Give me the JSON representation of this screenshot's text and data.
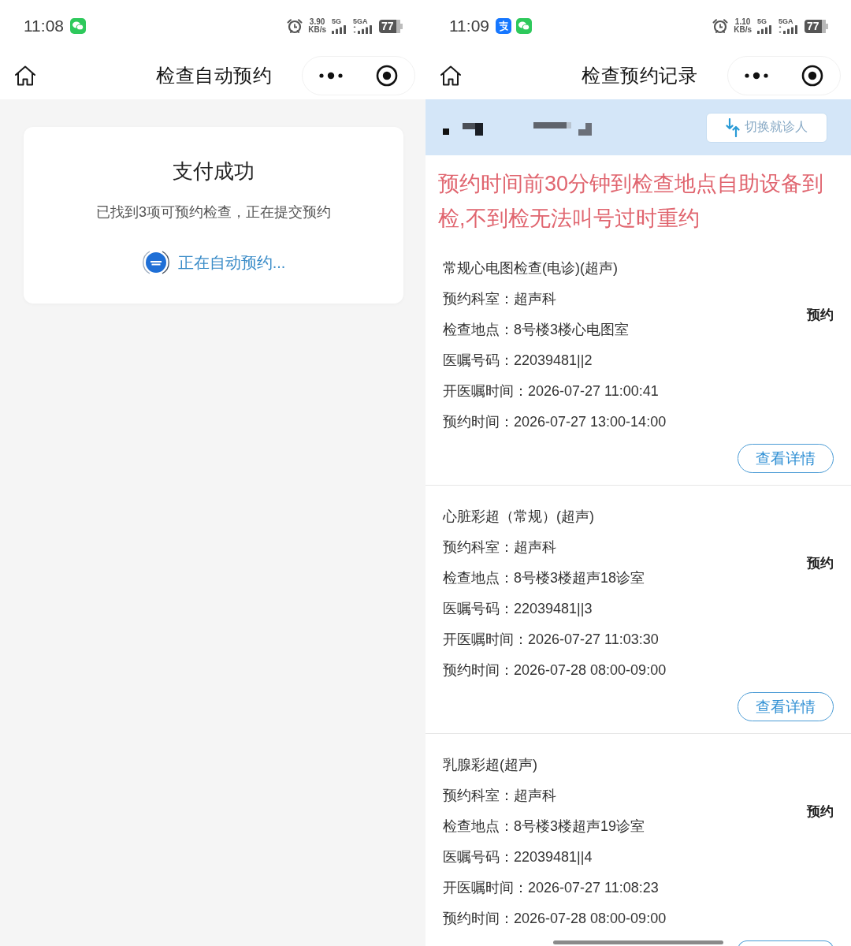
{
  "screens": [
    {
      "kind": "payment_status",
      "status_bar": {
        "time": "11:08",
        "notification_icons": [
          {
            "kind": "chat"
          }
        ],
        "net_speed": "3.90",
        "net_speed_unit": "KB/s",
        "sim_1_label": "5G",
        "sim_2_label": "5GA",
        "battery": "77"
      },
      "nav": {
        "title": "检查自动预约"
      },
      "result_card": {
        "title": "支付成功",
        "message": "已找到3项可预约检查，正在提交预约",
        "progress": "正在自动预约..."
      }
    },
    {
      "kind": "records",
      "status_bar": {
        "time": "11:09",
        "notification_icons": [
          {
            "kind": "pay"
          },
          {
            "kind": "chat"
          }
        ],
        "net_speed": "1.10",
        "net_speed_unit": "KB/s",
        "sim_1_label": "5G",
        "sim_2_label": "5GA",
        "battery": "77"
      },
      "nav": {
        "title": "检查预约记录"
      },
      "patient_bar": {
        "switch_button": "切换就诊人"
      },
      "notice": "预约时间前30分钟到检查地点自助设备到检,不到检无法叫号过时重约",
      "records": [
        {
          "name": "常规心电图检查(电诊)(超声)",
          "fields": [
            "预约科室：超声科",
            "检查地点：8号楼3楼心电图室",
            "医嘱号码：22039481||2",
            "开医嘱时间：2026-07-27 11:00:41",
            "预约时间：2026-07-27 13:00-14:00"
          ],
          "status": "预约",
          "action": {
            "kind": "button",
            "label": "查看详情"
          }
        },
        {
          "name": "心脏彩超（常规）(超声)",
          "fields": [
            "预约科室：超声科",
            "检查地点：8号楼3楼超声18诊室",
            "医嘱号码：22039481||3",
            "开医嘱时间：2026-07-27 11:03:30",
            "预约时间：2026-07-28 08:00-09:00"
          ],
          "status": "预约",
          "action": {
            "kind": "button",
            "label": "查看详情"
          }
        },
        {
          "name": "乳腺彩超(超声)",
          "fields": [
            "预约科室：超声科",
            "检查地点：8号楼3楼超声19诊室",
            "医嘱号码：22039481||4",
            "开医嘱时间：2026-07-27 11:08:23",
            "预约时间：2026-07-28 08:00-09:00"
          ],
          "status": "预约",
          "action": {
            "kind": "clipped_button"
          }
        }
      ]
    }
  ]
}
